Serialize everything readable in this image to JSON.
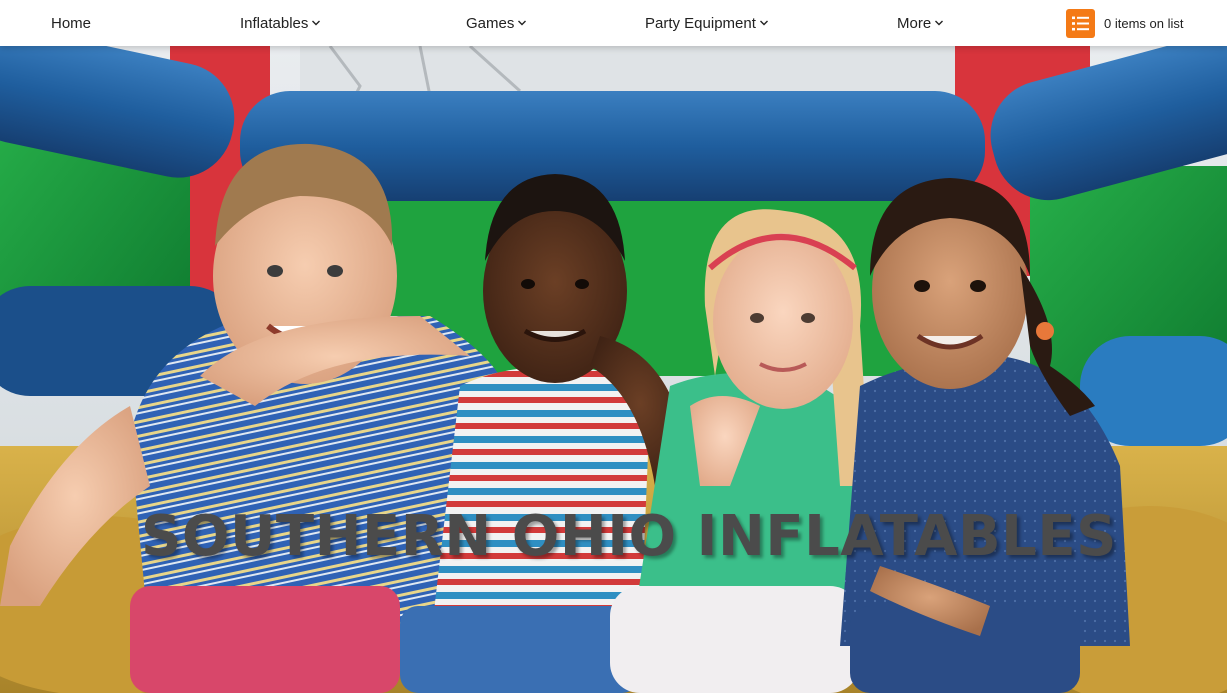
{
  "nav": {
    "items": [
      {
        "label": "Home",
        "has_dropdown": false
      },
      {
        "label": "Inflatables",
        "has_dropdown": true
      },
      {
        "label": "Games",
        "has_dropdown": true
      },
      {
        "label": "Party Equipment",
        "has_dropdown": true
      },
      {
        "label": "More",
        "has_dropdown": true
      }
    ],
    "list_icon": "list-icon",
    "list_count_label": "0 items on list"
  },
  "hero": {
    "title": "SOUTHERN OHIO INFLATABLES",
    "image": "photo of four smiling children sitting arm in arm on a colorful bounce house"
  },
  "colors": {
    "accent": "#f47a16",
    "nav_background": "#ffffff",
    "title_text": "#4b4b4b"
  }
}
